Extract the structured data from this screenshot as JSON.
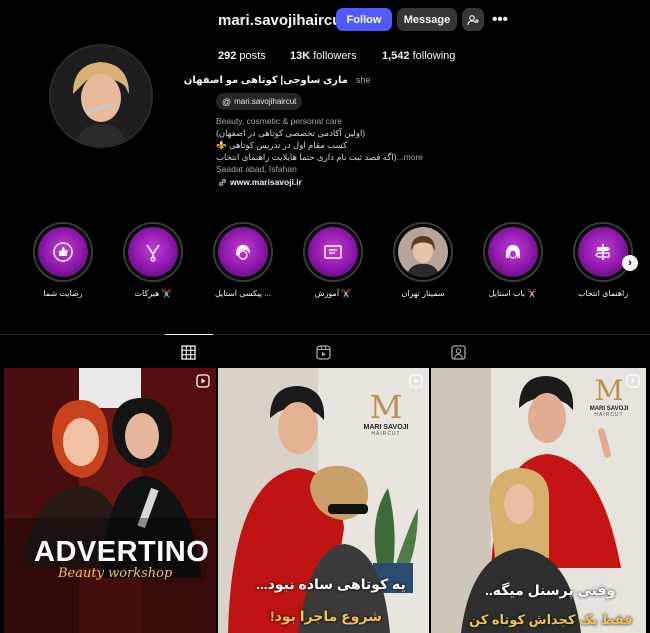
{
  "profile": {
    "username": "mari.savojihaircut",
    "follow_label": "Follow",
    "message_label": "Message",
    "posts_count": "292",
    "posts_label": "posts",
    "followers_count": "13K",
    "followers_label": "followers",
    "following_count": "1,542",
    "following_label": "following",
    "full_name": "ماری ساوجی| کوتاهی مو اصفهان",
    "pronoun": "she",
    "threads_handle": "mari.savojihaircut",
    "bio_category": "Beauty, cosmetic & personal care",
    "bio_line1": "(اولین آکادمی تخصصی کوتاهی در اصفهان)",
    "bio_line2": "کسب مقام اول در تدریس کوتاهی ⚜️",
    "bio_line3": "(اگه قصد ثبت نام داری حتما هایلایت راهنمای انتخاب",
    "more_label": "...more",
    "bio_location": "Saadat abad, Isfahan",
    "website": "www.marisavoji.ir"
  },
  "highlights": [
    {
      "label": "رضایت شما",
      "icon": "thumbs-up-icon"
    },
    {
      "label": "هیرکات ✂️",
      "icon": "scissors-icon"
    },
    {
      "label": "پیکسی استایل ...",
      "icon": "pixie-hair-icon"
    },
    {
      "label": "آموزش ✂️",
      "icon": "education-icon"
    },
    {
      "label": "سمینار تهران",
      "icon": "photo-avatar"
    },
    {
      "label": "باب استایل ✂️",
      "icon": "bob-hair-icon"
    },
    {
      "label": "راهنمای انتخاب",
      "icon": "signpost-icon"
    }
  ],
  "tabs": {
    "posts_icon": "grid-icon",
    "reels_icon": "reels-icon",
    "tagged_icon": "tagged-icon"
  },
  "posts": [
    {
      "title": "ADVERTINO",
      "subtitle": "Beauty workshop",
      "icon": "reel-icon"
    },
    {
      "brand": "MARI SAVOJI",
      "brand_sub": "HAIRCUT",
      "caption1": "یه کوتاهی ساده نبود...",
      "caption2": "شروع ماجرا بود!",
      "icon": "reel-icon"
    },
    {
      "brand": "MARI SAVOJI",
      "brand_sub": "HAIRCUT",
      "caption1": "وقتی پرسنل میگه..",
      "caption2": "فقط یک کجداش کوتاه کن",
      "icon": "reel-icon"
    }
  ],
  "colors": {
    "accent": "#4f5bff",
    "highlight_purple": "#a11fc4",
    "background": "#000000"
  }
}
